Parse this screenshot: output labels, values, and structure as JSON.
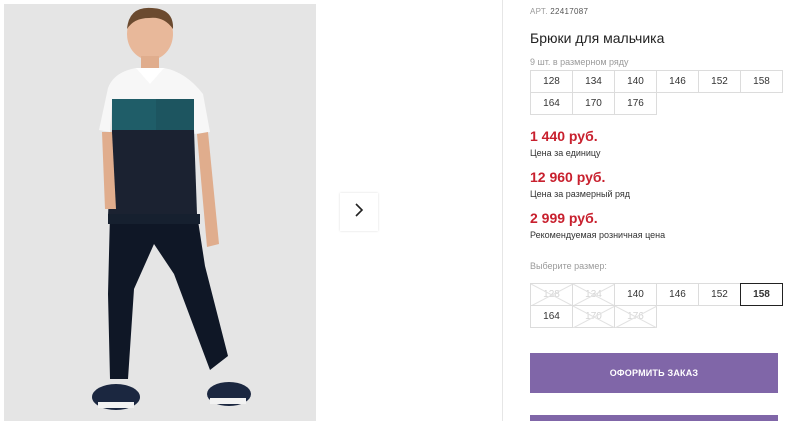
{
  "product": {
    "article_label": "АРТ.",
    "article_value": "22417087",
    "title": "Брюки для мальчика",
    "size_range_note": "9 шт. в размерном ряду",
    "range_sizes": [
      "128",
      "134",
      "140",
      "146",
      "152",
      "158",
      "164",
      "170",
      "176"
    ],
    "prices": [
      {
        "value": "1 440 руб.",
        "label": "Цена за единицу"
      },
      {
        "value": "12 960 руб.",
        "label": "Цена за размерный ряд"
      },
      {
        "value": "2 999 руб.",
        "label": "Рекомендуемая розничная цена"
      }
    ],
    "choose_size_label": "Выберите размер:",
    "size_options": [
      {
        "label": "128",
        "state": "disabled"
      },
      {
        "label": "134",
        "state": "disabled"
      },
      {
        "label": "140",
        "state": "available"
      },
      {
        "label": "146",
        "state": "available"
      },
      {
        "label": "152",
        "state": "available"
      },
      {
        "label": "158",
        "state": "selected"
      },
      {
        "label": "164",
        "state": "available"
      },
      {
        "label": "170",
        "state": "disabled"
      },
      {
        "label": "176",
        "state": "disabled"
      }
    ],
    "order_button_label": "ОФОРМИТЬ ЗАКАЗ"
  },
  "colors": {
    "price": "#c8202e",
    "order_button": "#8066a8",
    "photo_background": "#e5e5e5"
  },
  "icons": {
    "gallery_next": "chevron-right-icon"
  }
}
